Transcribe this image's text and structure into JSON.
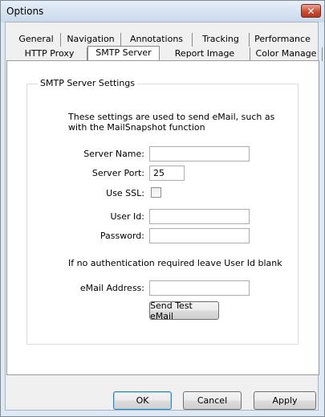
{
  "window": {
    "title": "Options",
    "close_label": "✕"
  },
  "tabs_row1": [
    {
      "label": "General"
    },
    {
      "label": "Navigation"
    },
    {
      "label": "Annotations"
    },
    {
      "label": "Tracking"
    },
    {
      "label": "Performance"
    }
  ],
  "tabs_row2": [
    {
      "label": "HTTP Proxy"
    },
    {
      "label": "SMTP Server",
      "selected": true
    },
    {
      "label": "Report Image"
    },
    {
      "label": "Color Manage"
    }
  ],
  "smtp": {
    "group_title": "SMTP Server Settings",
    "description": "These settings are used to send eMail, such as with the MailSnapshot function",
    "server_name_label": "Server Name:",
    "server_name_value": "",
    "server_port_label": "Server Port:",
    "server_port_value": "25",
    "use_ssl_label": "Use SSL:",
    "use_ssl_checked": false,
    "user_id_label": "User Id:",
    "user_id_value": "",
    "password_label": "Password:",
    "password_value": "",
    "auth_note": "If no authentication required leave User Id blank",
    "email_label": "eMail Address:",
    "email_value": "",
    "send_test_label": "Send Test eMail"
  },
  "footer": {
    "ok_label": "OK",
    "cancel_label": "Cancel",
    "apply_label": "Apply"
  }
}
